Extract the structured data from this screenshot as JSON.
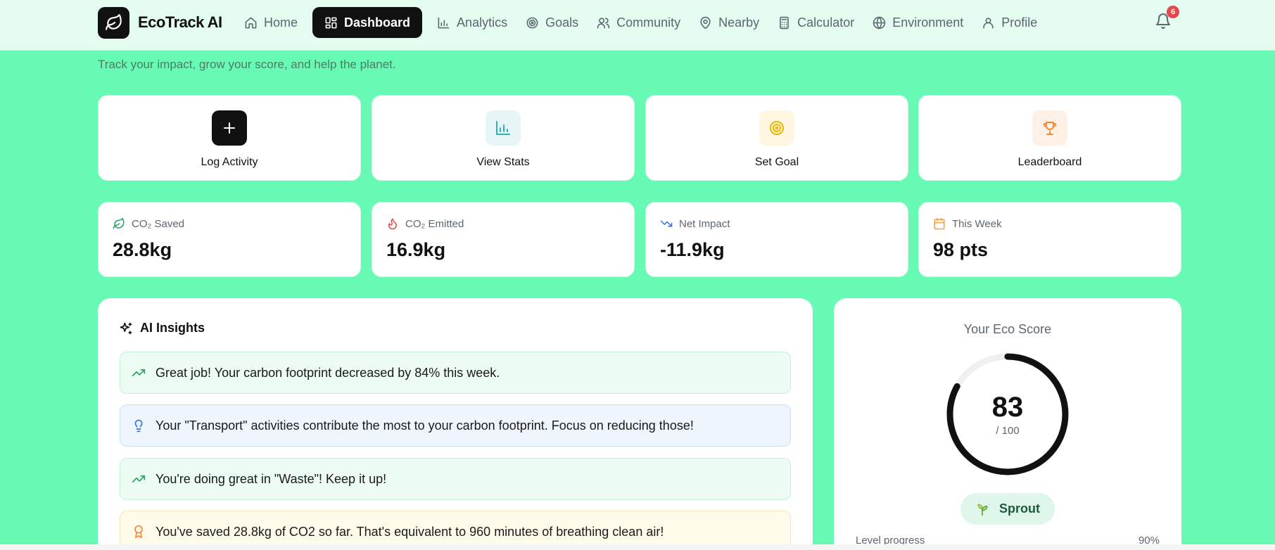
{
  "app": {
    "name": "EcoTrack AI"
  },
  "nav": {
    "items": [
      {
        "label": "Home",
        "icon": "home-icon"
      },
      {
        "label": "Dashboard",
        "icon": "dashboard-icon",
        "active": true
      },
      {
        "label": "Analytics",
        "icon": "bar-chart-icon"
      },
      {
        "label": "Goals",
        "icon": "target-icon"
      },
      {
        "label": "Community",
        "icon": "users-icon"
      },
      {
        "label": "Nearby",
        "icon": "map-pin-icon"
      },
      {
        "label": "Calculator",
        "icon": "calculator-icon"
      },
      {
        "label": "Environment",
        "icon": "globe-icon"
      },
      {
        "label": "Profile",
        "icon": "user-icon"
      }
    ],
    "notifications": {
      "count": "6"
    }
  },
  "header": {
    "subtitle": "Track your impact, grow your score, and help the planet."
  },
  "quick_actions": [
    {
      "label": "Log Activity",
      "icon": "plus-icon",
      "color": "#111111"
    },
    {
      "label": "View Stats",
      "icon": "bar-chart-icon",
      "color": "#2bb3b8"
    },
    {
      "label": "Set Goal",
      "icon": "target-icon",
      "color": "#e8b400"
    },
    {
      "label": "Leaderboard",
      "icon": "trophy-icon",
      "color": "#f28a3b"
    }
  ],
  "stats": [
    {
      "label": "CO₂ Saved",
      "value": "28.8kg",
      "icon": "leaf-icon",
      "color": "#22a45d"
    },
    {
      "label": "CO₂ Emitted",
      "value": "16.9kg",
      "icon": "flame-icon",
      "color": "#e5484d"
    },
    {
      "label": "Net Impact",
      "value": "-11.9kg",
      "icon": "trending-down-icon",
      "color": "#2f6fe4"
    },
    {
      "label": "This Week",
      "value": "98 pts",
      "icon": "calendar-icon",
      "color": "#f2a23b"
    }
  ],
  "insights": {
    "title": "AI Insights",
    "items": [
      {
        "text": "Great job! Your carbon footprint decreased by 84% this week.",
        "icon": "trending-up-icon",
        "tone": "green"
      },
      {
        "text": "Your \"Transport\" activities contribute the most to your carbon footprint. Focus on reducing those!",
        "icon": "lightbulb-icon",
        "tone": "blue"
      },
      {
        "text": "You're doing great in \"Waste\"! Keep it up!",
        "icon": "trending-up-icon",
        "tone": "green"
      },
      {
        "text": "You've saved 28.8kg of CO2 so far. That's equivalent to 960 minutes of breathing clean air!",
        "icon": "award-icon",
        "tone": "amber"
      }
    ]
  },
  "eco_score": {
    "title": "Your Eco Score",
    "value": "83",
    "max_label": "/ 100",
    "fraction": 0.83,
    "level": "Sprout",
    "level_icon": "sprout-icon",
    "progress_label": "Level progress",
    "progress_value": "90%"
  }
}
